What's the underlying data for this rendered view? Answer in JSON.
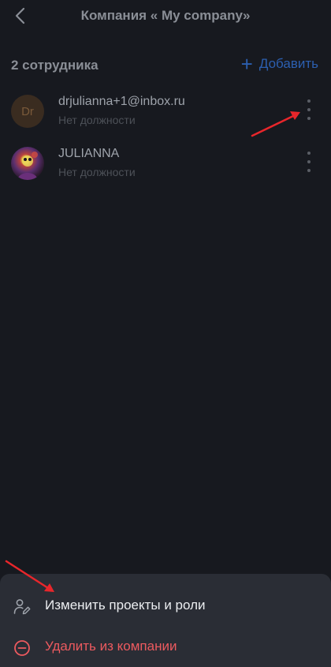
{
  "header": {
    "title": "Компания « My company»"
  },
  "section": {
    "count_label": "2 сотрудника",
    "add_label": "Добавить"
  },
  "members": [
    {
      "initials": "Dr",
      "name": "drjulianna+1@inbox.ru",
      "role": "Нет должности"
    },
    {
      "initials": "",
      "name": "JULIANNA",
      "role": "Нет должности"
    }
  ],
  "action_sheet": {
    "edit_label": "Изменить проекты и роли",
    "remove_label": "Удалить из компании"
  },
  "colors": {
    "accent": "#2c5fb0",
    "danger": "#ec5a5f",
    "annotation": "#e8262b"
  },
  "icons": [
    "back-icon",
    "plus-icon",
    "more-vertical-icon",
    "user-edit-icon",
    "minus-circle-icon",
    "annotation-arrow"
  ]
}
